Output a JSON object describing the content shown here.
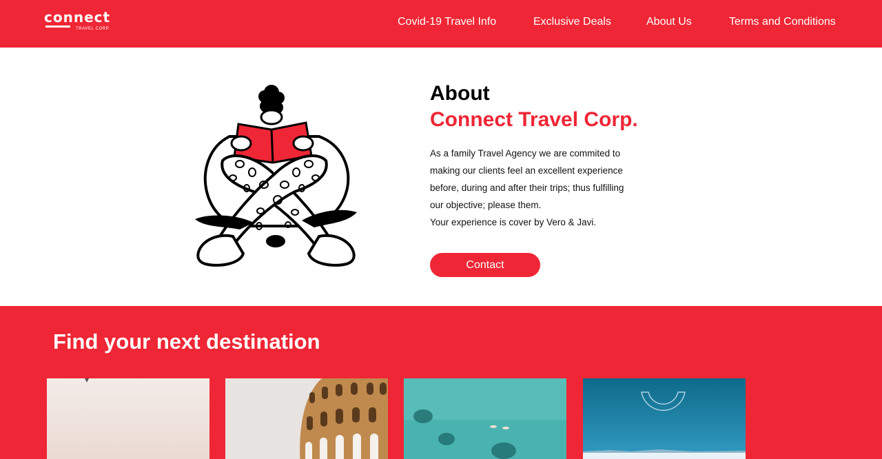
{
  "header": {
    "logo": {
      "word": "connect",
      "sub": "TRAVEL CORP."
    },
    "nav": [
      {
        "label": "Covid-19 Travel Info"
      },
      {
        "label": "Exclusive Deals"
      },
      {
        "label": "About Us"
      },
      {
        "label": "Terms and Conditions"
      }
    ]
  },
  "about": {
    "heading_line1": "About",
    "heading_line2": "Connect Travel Corp.",
    "body_lines": [
      "As a family Travel Agency we are commited to",
      "making our clients feel an excellent experience",
      "before, during and after their trips; thus fulfilling",
      "our objective; please them.",
      "Your experience is cover by Vero & Javi."
    ],
    "contact_label": "Contact"
  },
  "destinations": {
    "title": "Find your next destination",
    "cards": [
      {
        "image": "pastel-beach-photo"
      },
      {
        "image": "colosseum-photo"
      },
      {
        "image": "turquoise-sea-palms-photo"
      },
      {
        "image": "blue-horizon-photo"
      }
    ]
  },
  "colors": {
    "brand_red": "#ef2635",
    "text_dark": "#111111",
    "white": "#ffffff"
  }
}
